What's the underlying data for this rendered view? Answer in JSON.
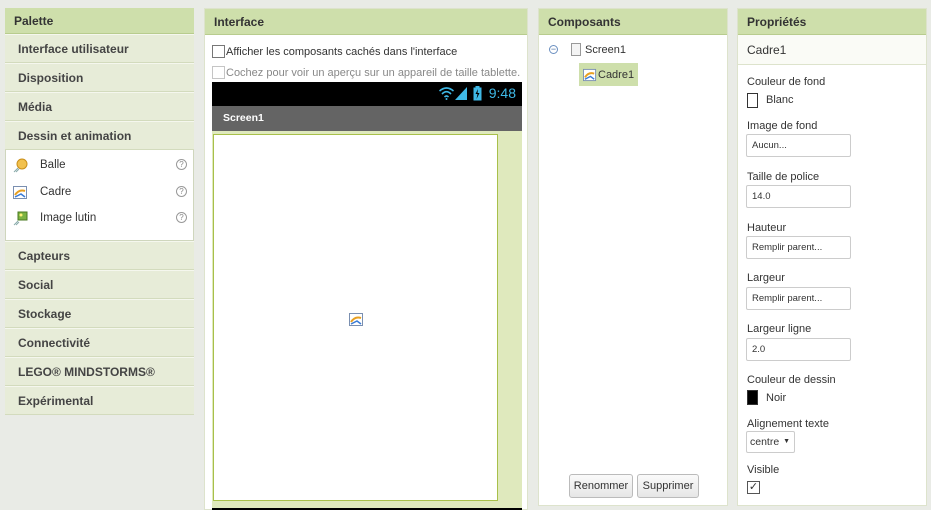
{
  "palette": {
    "title": "Palette",
    "categories_top": [
      {
        "label": "Interface utilisateur"
      },
      {
        "label": "Disposition"
      },
      {
        "label": "Média"
      },
      {
        "label": "Dessin et animation"
      }
    ],
    "items": [
      {
        "label": "Balle",
        "icon": "ball-icon"
      },
      {
        "label": "Cadre",
        "icon": "canvas-icon"
      },
      {
        "label": "Image lutin",
        "icon": "image-sprite-icon"
      }
    ],
    "help_glyph": "?",
    "categories_bottom": [
      {
        "label": "Capteurs"
      },
      {
        "label": "Social"
      },
      {
        "label": "Stockage"
      },
      {
        "label": "Connectivité"
      },
      {
        "label": "LEGO® MINDSTORMS®"
      },
      {
        "label": "Expérimental"
      }
    ]
  },
  "interface": {
    "title": "Interface",
    "show_hidden_label": "Afficher les composants cachés dans l'interface",
    "tablet_preview_label": "Cochez pour voir un aperçu sur un appareil de taille tablette.",
    "phone": {
      "time": "9:48",
      "screen_title": "Screen1"
    }
  },
  "components": {
    "title": "Composants",
    "toggle_glyph": "−",
    "root": "Screen1",
    "child": "Cadre1",
    "rename_label": "Renommer",
    "delete_label": "Supprimer"
  },
  "properties": {
    "title": "Propriétés",
    "component_name": "Cadre1",
    "background_color_label": "Couleur de fond",
    "background_color_value": "Blanc",
    "background_color_hex": "#ffffff",
    "background_image_label": "Image de fond",
    "background_image_value": "Aucun...",
    "font_size_label": "Taille de police",
    "font_size_value": "14.0",
    "height_label": "Hauteur",
    "height_value": "Remplir parent...",
    "width_label": "Largeur",
    "width_value": "Remplir parent...",
    "line_width_label": "Largeur ligne",
    "line_width_value": "2.0",
    "paint_color_label": "Couleur de dessin",
    "paint_color_value": "Noir",
    "paint_color_hex": "#000000",
    "text_alignment_label": "Alignement texte",
    "text_alignment_value": "centre",
    "visible_label": "Visible",
    "visible_checked": true,
    "check_glyph": "✓"
  },
  "colors": {
    "header_bg": "#cedfab",
    "selected_bg": "#cedfab",
    "clock": "#3fb9e6",
    "titlebar": "#646464"
  }
}
